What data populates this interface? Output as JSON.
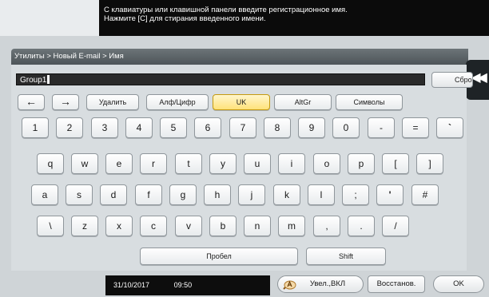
{
  "message": {
    "line1": "С клавиатуры или клавишной панели введите регистрационное имя.",
    "line2": "Нажмите [C] для стирания введенного имени."
  },
  "breadcrumb": "Утилиты > Новый E-mail > Имя",
  "input": {
    "value": "Group1"
  },
  "reset_label": "Сбро",
  "side_tab_glyph": "◀◀",
  "fn_keys": {
    "left": "←",
    "right": "→",
    "delete": "Удалить",
    "alnum": "Алф/Цифр",
    "uk": "UK",
    "altgr": "AltGr",
    "symbols": "Символы"
  },
  "rows": {
    "r1": [
      "1",
      "2",
      "3",
      "4",
      "5",
      "6",
      "7",
      "8",
      "9",
      "0",
      "-",
      "=",
      "`"
    ],
    "r2": [
      "q",
      "w",
      "e",
      "r",
      "t",
      "y",
      "u",
      "i",
      "o",
      "p",
      "[",
      "]"
    ],
    "r3": [
      "a",
      "s",
      "d",
      "f",
      "g",
      "h",
      "j",
      "k",
      "l",
      ";",
      "'",
      "#"
    ],
    "r4": [
      "\\",
      "z",
      "x",
      "c",
      "v",
      "b",
      "n",
      "m",
      ",",
      ".",
      "/"
    ]
  },
  "space_label": "Пробел",
  "shift_label": "Shift",
  "status": {
    "date": "31/10/2017",
    "time": "09:50"
  },
  "footer": {
    "zoom_label": "Увел.,ВКЛ",
    "restore_label": "Восстанов.",
    "ok_label": "OK"
  },
  "selected_key": "uk"
}
